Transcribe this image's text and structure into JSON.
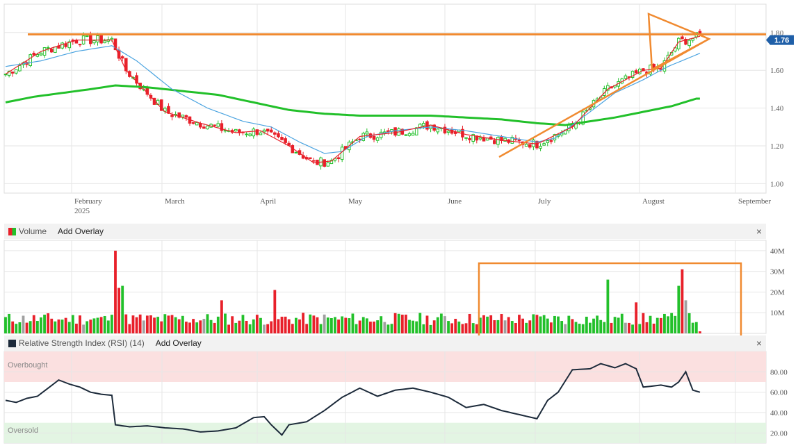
{
  "price_panel": {
    "months": [
      "February",
      "March",
      "April",
      "May",
      "June",
      "July",
      "August",
      "September"
    ],
    "year_label": "2025",
    "yticks": [
      "1.00",
      "1.20",
      "1.40",
      "1.60",
      "1.80"
    ],
    "last_price_label": "1.76"
  },
  "volume_panel": {
    "title": "Volume",
    "add_overlay": "Add Overlay",
    "close": "×",
    "yticks": [
      "10M",
      "20M",
      "30M",
      "40M"
    ]
  },
  "rsi_panel": {
    "title": "Relative Strength Index (RSI) (14)",
    "add_overlay": "Add Overlay",
    "close": "×",
    "yticks": [
      "20.00",
      "40.00",
      "60.00",
      "80.00"
    ],
    "overbought_label": "Overbought",
    "oversold_label": "Oversold"
  },
  "colors": {
    "up": "#22c02a",
    "down": "#e8202a",
    "neutral": "#a0a0a0",
    "ma_fast": "#e8202a",
    "ma_mid": "#4aa3e0",
    "ma_slow": "#22c02a",
    "annotation": "#f08a30",
    "rsi_line": "#1c2a3a",
    "overbought_band": "#fbe0e0",
    "oversold_band": "#e3f5e3",
    "price_tag": "#1f5fa8"
  },
  "chart_data": [
    {
      "type": "candlestick",
      "ylim": [
        0.95,
        1.95
      ],
      "ma_slow_y": [
        [
          0,
          1.43
        ],
        [
          8,
          1.46
        ],
        [
          16,
          1.48
        ],
        [
          24,
          1.5
        ],
        [
          31,
          1.52
        ],
        [
          40,
          1.51
        ],
        [
          50,
          1.49
        ],
        [
          60,
          1.47
        ],
        [
          70,
          1.43
        ],
        [
          80,
          1.39
        ],
        [
          90,
          1.37
        ],
        [
          100,
          1.36
        ],
        [
          110,
          1.36
        ],
        [
          120,
          1.36
        ],
        [
          130,
          1.35
        ],
        [
          140,
          1.34
        ],
        [
          150,
          1.32
        ],
        [
          158,
          1.31
        ],
        [
          165,
          1.33
        ],
        [
          172,
          1.35
        ],
        [
          180,
          1.38
        ],
        [
          188,
          1.41
        ],
        [
          195,
          1.45
        ]
      ],
      "ma_mid_y": [
        [
          0,
          1.62
        ],
        [
          10,
          1.65
        ],
        [
          20,
          1.7
        ],
        [
          30,
          1.73
        ],
        [
          37,
          1.65
        ],
        [
          47,
          1.5
        ],
        [
          57,
          1.4
        ],
        [
          67,
          1.33
        ],
        [
          75,
          1.3
        ],
        [
          83,
          1.22
        ],
        [
          90,
          1.16
        ],
        [
          95,
          1.17
        ],
        [
          102,
          1.25
        ],
        [
          110,
          1.28
        ],
        [
          120,
          1.3
        ],
        [
          130,
          1.28
        ],
        [
          140,
          1.25
        ],
        [
          150,
          1.22
        ],
        [
          155,
          1.24
        ],
        [
          165,
          1.38
        ],
        [
          172,
          1.48
        ],
        [
          180,
          1.55
        ],
        [
          187,
          1.62
        ],
        [
          196,
          1.69
        ]
      ],
      "ma_fast_y": [
        [
          0,
          1.58
        ],
        [
          10,
          1.7
        ],
        [
          20,
          1.76
        ],
        [
          30,
          1.76
        ],
        [
          34,
          1.6
        ],
        [
          45,
          1.38
        ],
        [
          55,
          1.32
        ],
        [
          65,
          1.27
        ],
        [
          72,
          1.28
        ],
        [
          80,
          1.2
        ],
        [
          87,
          1.11
        ],
        [
          92,
          1.12
        ],
        [
          100,
          1.25
        ],
        [
          110,
          1.27
        ],
        [
          120,
          1.31
        ],
        [
          130,
          1.26
        ],
        [
          140,
          1.23
        ],
        [
          150,
          1.21
        ],
        [
          160,
          1.3
        ],
        [
          170,
          1.5
        ],
        [
          180,
          1.6
        ],
        [
          185,
          1.61
        ],
        [
          190,
          1.75
        ],
        [
          196,
          1.78
        ]
      ],
      "horizontal_line_y": 1.79
    },
    {
      "type": "bar",
      "ylim": [
        0,
        45
      ],
      "x_sessions": 197
    },
    {
      "type": "line",
      "ylim": [
        10,
        100
      ],
      "overbought": [
        70,
        100
      ],
      "oversold": [
        0,
        30
      ],
      "rsi_points": [
        [
          0,
          52
        ],
        [
          3,
          50
        ],
        [
          6,
          54
        ],
        [
          9,
          56
        ],
        [
          12,
          64
        ],
        [
          15,
          72
        ],
        [
          18,
          68
        ],
        [
          21,
          65
        ],
        [
          24,
          60
        ],
        [
          27,
          58
        ],
        [
          30,
          57
        ],
        [
          31,
          28
        ],
        [
          35,
          26
        ],
        [
          40,
          27
        ],
        [
          45,
          25
        ],
        [
          50,
          24
        ],
        [
          55,
          21
        ],
        [
          60,
          22
        ],
        [
          65,
          25
        ],
        [
          70,
          35
        ],
        [
          73,
          36
        ],
        [
          75,
          28
        ],
        [
          78,
          18
        ],
        [
          80,
          28
        ],
        [
          85,
          31
        ],
        [
          90,
          42
        ],
        [
          95,
          55
        ],
        [
          100,
          64
        ],
        [
          105,
          56
        ],
        [
          110,
          62
        ],
        [
          115,
          64
        ],
        [
          120,
          60
        ],
        [
          125,
          55
        ],
        [
          130,
          45
        ],
        [
          135,
          48
        ],
        [
          140,
          42
        ],
        [
          145,
          38
        ],
        [
          150,
          34
        ],
        [
          153,
          52
        ],
        [
          156,
          60
        ],
        [
          160,
          82
        ],
        [
          165,
          83
        ],
        [
          168,
          88
        ],
        [
          172,
          84
        ],
        [
          175,
          88
        ],
        [
          178,
          83
        ],
        [
          180,
          65
        ],
        [
          185,
          67
        ],
        [
          188,
          65
        ],
        [
          190,
          70
        ],
        [
          192,
          80
        ],
        [
          194,
          62
        ],
        [
          196,
          60
        ]
      ]
    }
  ]
}
